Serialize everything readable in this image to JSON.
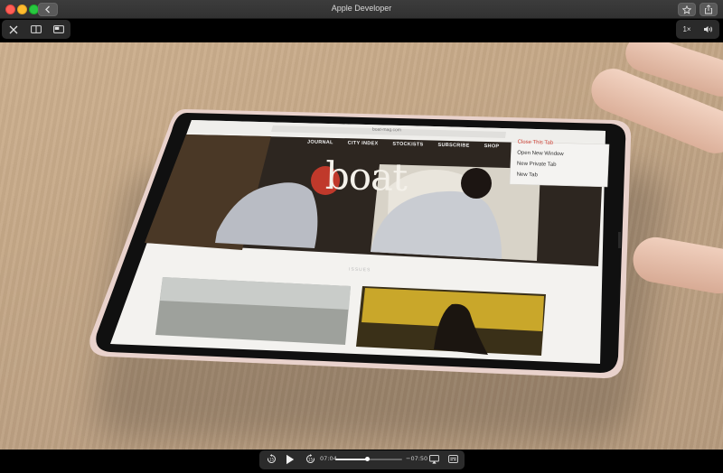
{
  "window": {
    "title": "Apple Developer"
  },
  "player": {
    "speed": "1×",
    "current_time": "07:04",
    "remaining_time": "−07:50",
    "progress": 0.475
  },
  "ipad_screen": {
    "url": "boat-mag.com",
    "site_logo": "boat",
    "nav": [
      "JOURNAL",
      "CITY INDEX",
      "STOCKISTS",
      "SUBSCRIBE",
      "SHOP"
    ],
    "section_label": "ISSUES",
    "menu": [
      "Close This Tab",
      "Open New Window",
      "New Private Tab",
      "New Tab"
    ]
  }
}
